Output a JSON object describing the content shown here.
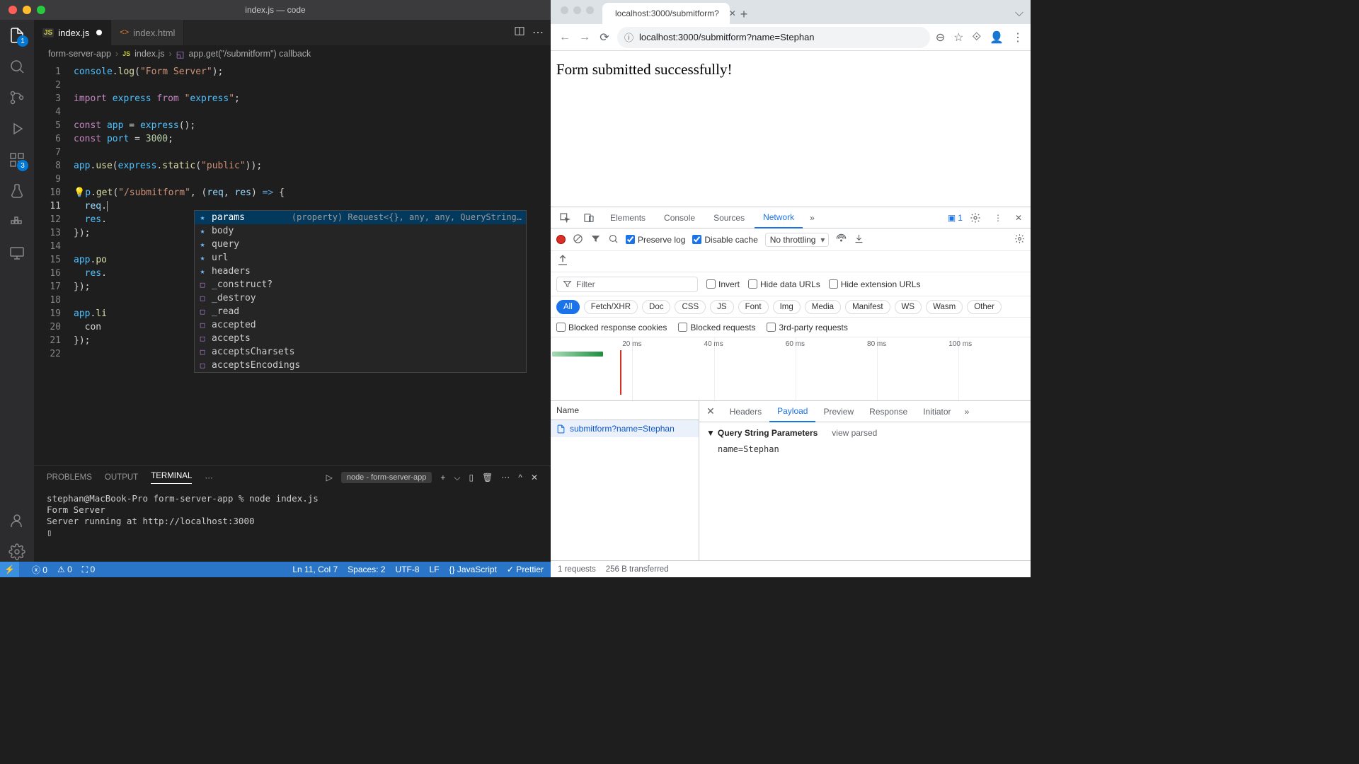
{
  "vscode": {
    "title": "index.js — code",
    "tabs": [
      {
        "label": "index.js",
        "active": true,
        "modified": true,
        "icon": "js"
      },
      {
        "label": "index.html",
        "active": false,
        "modified": false,
        "icon": "html"
      }
    ],
    "breadcrumb": {
      "folder": "form-server-app",
      "file": "index.js",
      "symbol": "app.get(\"/submitform\") callback"
    },
    "activity": {
      "explorer_badge": "1",
      "ext_badge": "3"
    },
    "code_lines": [
      "console.log(\"Form Server\");",
      "",
      "import express from \"express\";",
      "",
      "const app = express();",
      "const port = 3000;",
      "",
      "app.use(express.static(\"public\"));",
      "",
      "app.get(\"/submitform\", (req, res) => {",
      "  req.",
      "  res.",
      "});",
      "",
      "app.po",
      "  res.",
      "});",
      "",
      "app.li",
      "  con",
      "});",
      ""
    ],
    "line_numbers": [
      "1",
      "2",
      "3",
      "4",
      "5",
      "6",
      "7",
      "8",
      "9",
      "10",
      "11",
      "12",
      "13",
      "14",
      "15",
      "16",
      "17",
      "18",
      "19",
      "20",
      "21",
      "22"
    ],
    "current_line": 11,
    "intellisense": {
      "detail": "(property) Request<{}, any, any, QueryString…",
      "items": [
        {
          "kind": "★",
          "label": "params",
          "selected": true
        },
        {
          "kind": "★",
          "label": "body"
        },
        {
          "kind": "★",
          "label": "query"
        },
        {
          "kind": "★",
          "label": "url"
        },
        {
          "kind": "★",
          "label": "headers"
        },
        {
          "kind": "□",
          "label": "_construct?"
        },
        {
          "kind": "□",
          "label": "_destroy"
        },
        {
          "kind": "□",
          "label": "_read"
        },
        {
          "kind": "□",
          "label": "accepted"
        },
        {
          "kind": "□",
          "label": "accepts"
        },
        {
          "kind": "□",
          "label": "acceptsCharsets"
        },
        {
          "kind": "□",
          "label": "acceptsEncodings"
        }
      ]
    },
    "panel": {
      "tabs": [
        "PROBLEMS",
        "OUTPUT",
        "TERMINAL",
        "⋯"
      ],
      "active": "TERMINAL",
      "terminal_selector": "node - form-server-app",
      "content": "stephan@MacBook-Pro form-server-app % node index.js\nForm Server\nServer running at http://localhost:3000\n▯"
    },
    "status": {
      "errors": "0",
      "warnings": "0",
      "port_fwd": "0",
      "cursor": "Ln 11, Col 7",
      "spaces": "Spaces: 2",
      "encoding": "UTF-8",
      "eol": "LF",
      "lang": "{} JavaScript",
      "prettier": "✓ Prettier"
    }
  },
  "chrome": {
    "tab_title": "localhost:3000/submitform?",
    "url": "localhost:3000/submitform?name=Stephan",
    "page_text": "Form submitted successfully!",
    "devtools": {
      "tabs": [
        "Elements",
        "Console",
        "Sources",
        "Network"
      ],
      "active": "Network",
      "issues": "1",
      "preserve_log": "Preserve log",
      "disable_cache": "Disable cache",
      "throttling": "No throttling",
      "filter_placeholder": "Filter",
      "filter_options": [
        "Invert",
        "Hide data URLs",
        "Hide extension URLs"
      ],
      "types": [
        "All",
        "Fetch/XHR",
        "Doc",
        "CSS",
        "JS",
        "Font",
        "Img",
        "Media",
        "Manifest",
        "WS",
        "Wasm",
        "Other"
      ],
      "type_active": "All",
      "block_options": [
        "Blocked response cookies",
        "Blocked requests",
        "3rd-party requests"
      ],
      "waterfall_ticks": [
        "20 ms",
        "40 ms",
        "60 ms",
        "80 ms",
        "100 ms"
      ],
      "list_header": "Name",
      "list_item": "submitform?name=Stephan",
      "detail_tabs": [
        "Headers",
        "Payload",
        "Preview",
        "Response",
        "Initiator"
      ],
      "detail_active": "Payload",
      "payload": {
        "section": "Query String Parameters",
        "view_link": "view parsed",
        "kv": "name=Stephan"
      },
      "status": {
        "requests": "1 requests",
        "transferred": "256 B transferred"
      }
    }
  }
}
